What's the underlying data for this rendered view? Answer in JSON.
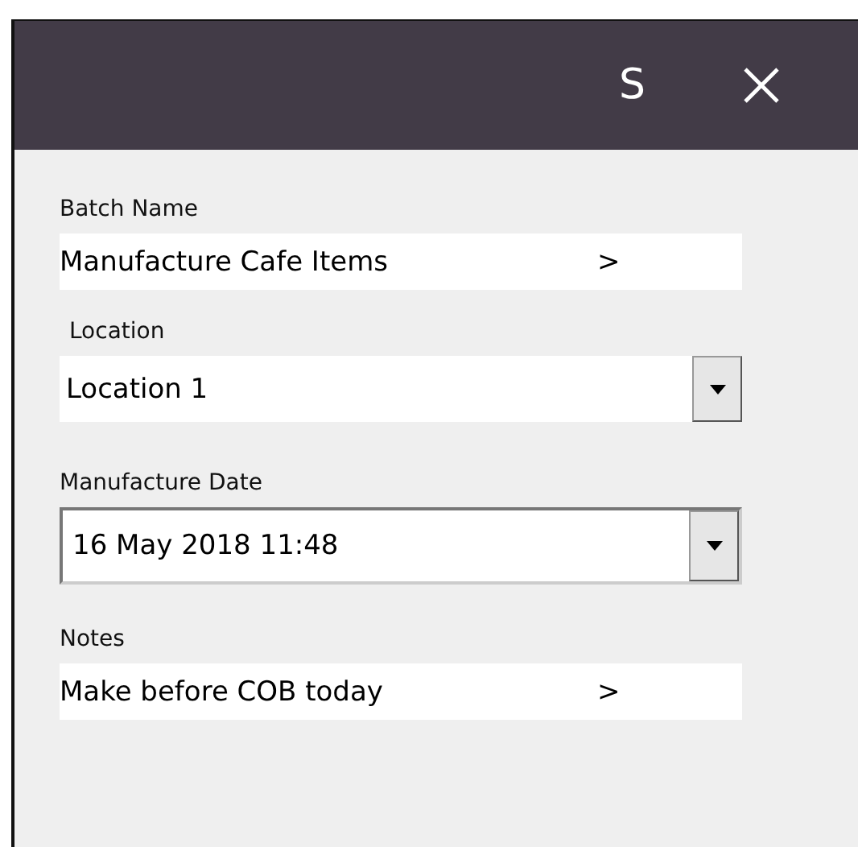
{
  "window": {
    "title": "S"
  },
  "fields": [
    {
      "kind": "picker",
      "label": "Batch Name",
      "value": "Manufacture Cafe Items",
      "arrow": ">"
    },
    {
      "kind": "combo",
      "label": "Location",
      "value": "Location 1"
    },
    {
      "kind": "datepicker",
      "label": "Manufacture Date",
      "value": "16 May 2018 11:48"
    },
    {
      "kind": "picker",
      "label": "Notes",
      "value": "Make before COB today",
      "arrow": ">"
    }
  ]
}
